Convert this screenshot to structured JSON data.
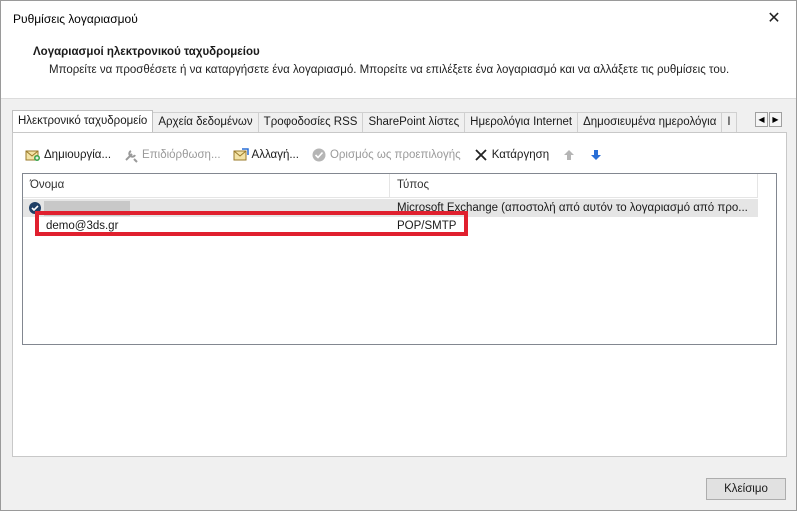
{
  "window": {
    "title": "Ρυθμίσεις λογαριασμού",
    "close_glyph": "✕"
  },
  "header": {
    "title": "Λογαριασμοί ηλεκτρονικού ταχυδρομείου",
    "subtitle": "Μπορείτε να προσθέσετε ή να καταργήσετε ένα λογαριασμό. Μπορείτε να επιλέξετε ένα λογαριασμό και να αλλάξετε τις ρυθμίσεις του."
  },
  "tabs": [
    {
      "label": "Ηλεκτρονικό ταχυδρομείο",
      "active": true
    },
    {
      "label": "Αρχεία δεδομένων",
      "active": false
    },
    {
      "label": "Τροφοδοσίες RSS",
      "active": false
    },
    {
      "label": "SharePoint λίστες",
      "active": false
    },
    {
      "label": "Ημερολόγια Internet",
      "active": false
    },
    {
      "label": "Δημοσιευμένα ημερολόγια",
      "active": false
    },
    {
      "label": "Ι",
      "active": false
    }
  ],
  "tab_scroll": {
    "left": "◀",
    "right": "▶"
  },
  "toolbar": {
    "new_label": "Δημιουργία...",
    "repair_label": "Επιδιόρθωση...",
    "change_label": "Αλλαγή...",
    "set_default_label": "Ορισμός ως προεπιλογής",
    "remove_label": "Κατάργηση",
    "up_icon": "up-arrow-icon",
    "down_icon": "down-arrow-icon"
  },
  "list": {
    "columns": [
      "Όνομα",
      "Τύπος"
    ],
    "rows": [
      {
        "name": "",
        "type": "Microsoft Exchange (αποστολή από αυτόν το λογαριασμό από προ...",
        "default": true,
        "selected": true
      },
      {
        "name": "demo@3ds.gr",
        "type": "POP/SMTP",
        "default": false,
        "selected": false
      }
    ]
  },
  "colors": {
    "highlight": "#e0202e",
    "selected_row": "#e5e5e5",
    "accent_blue": "#2a6fd6"
  },
  "footer": {
    "close_label": "Κλείσιμο"
  }
}
